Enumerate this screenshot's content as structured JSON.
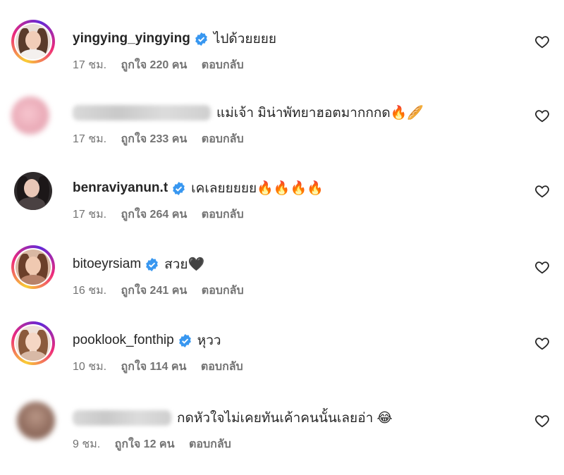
{
  "comments": [
    {
      "username": "yingying_yingying",
      "verified": true,
      "text": "ไปด้วยยยย",
      "time": "17 ชม.",
      "likes": "ถูกใจ 220 คน",
      "reply": "ตอบกลับ"
    },
    {
      "username": "",
      "verified": false,
      "text": "แม่เจ้า มิน่าพัทยาฮอตมากกกด🔥🥖",
      "time": "17 ชม.",
      "likes": "ถูกใจ 233 คน",
      "reply": "ตอบกลับ"
    },
    {
      "username": "benraviyanun.t",
      "verified": true,
      "text": "เคเลยยยยย🔥🔥🔥🔥",
      "time": "17 ชม.",
      "likes": "ถูกใจ 264 คน",
      "reply": "ตอบกลับ"
    },
    {
      "username": "bitoeyrsiam",
      "verified": true,
      "text": "สวย🖤",
      "time": "16 ชม.",
      "likes": "ถูกใจ 241 คน",
      "reply": "ตอบกลับ"
    },
    {
      "username": "pooklook_fonthip",
      "verified": true,
      "text": "หุวว",
      "time": "10 ชม.",
      "likes": "ถูกใจ 114 คน",
      "reply": "ตอบกลับ"
    },
    {
      "username": "",
      "verified": false,
      "text": "กดหัวใจไม่เคยทันเค้าคนนั้นเลยอ่า 😂",
      "time": "9 ชม.",
      "likes": "ถูกใจ 12 คน",
      "reply": "ตอบกลับ"
    }
  ],
  "colors": {
    "verified": "#3897f0",
    "text": "#262626",
    "meta": "#737373"
  }
}
